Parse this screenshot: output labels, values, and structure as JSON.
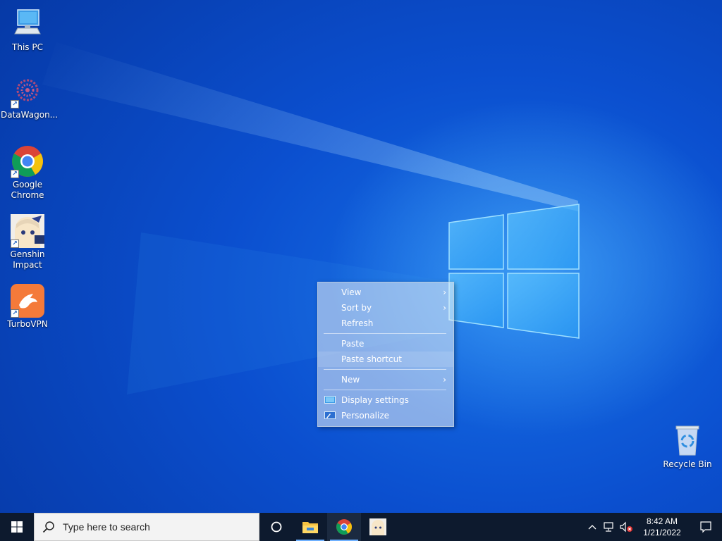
{
  "desktop": {
    "icons": [
      {
        "label": "This PC",
        "icon": "computer-icon"
      },
      {
        "label": "DataWagon...",
        "icon": "datawagon-icon"
      },
      {
        "label": "Google Chrome",
        "icon": "chrome-icon"
      },
      {
        "label": "Genshin Impact",
        "icon": "genshin-icon"
      },
      {
        "label": "TurboVPN",
        "icon": "turbovpn-icon"
      },
      {
        "label": "Recycle Bin",
        "icon": "recycle-bin-icon"
      }
    ]
  },
  "context_menu": {
    "items": [
      {
        "label": "View",
        "submenu": true
      },
      {
        "label": "Sort by",
        "submenu": true
      },
      {
        "label": "Refresh",
        "submenu": false
      },
      {
        "label": "Paste",
        "submenu": false
      },
      {
        "label": "Paste shortcut",
        "submenu": false,
        "highlighted": true
      },
      {
        "label": "New",
        "submenu": true
      },
      {
        "label": "Display settings",
        "icon": "display-settings-icon"
      },
      {
        "label": "Personalize",
        "icon": "personalize-icon"
      }
    ],
    "submenu_glyph": "›"
  },
  "taskbar": {
    "search_placeholder": "Type here to search",
    "pinned": [
      "file-explorer-icon",
      "chrome-icon",
      "genshin-icon"
    ],
    "clock_time": "8:42 AM",
    "clock_date": "1/21/2022",
    "colors": {
      "taskbar_bg": "#0d1a2e",
      "active_underline": "#6fb1ff"
    }
  }
}
